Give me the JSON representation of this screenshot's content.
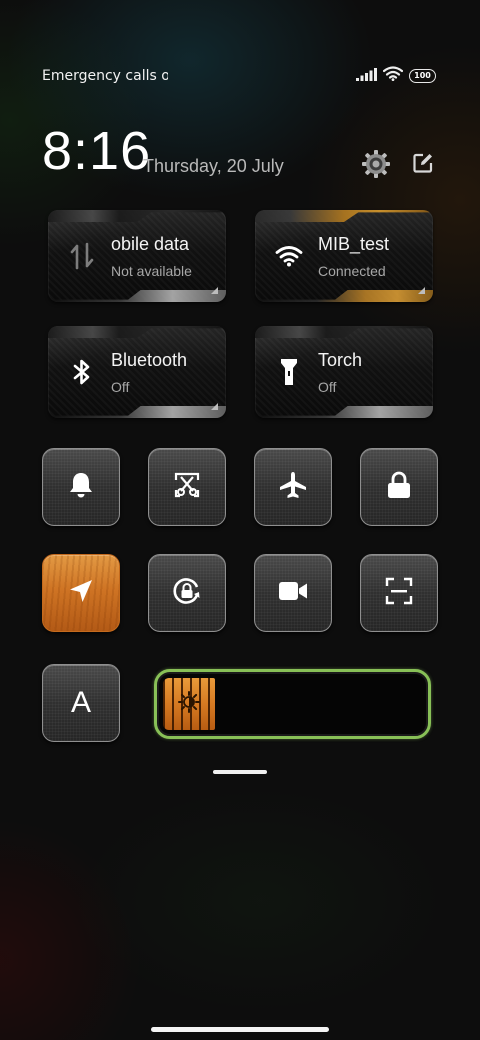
{
  "status_bar": {
    "carrier": "Emergency calls o",
    "battery": "100"
  },
  "header": {
    "time": "8:16",
    "date": "Thursday, 20 July",
    "settings_icon": "gear-icon",
    "edit_icon": "edit-icon"
  },
  "big_tiles": [
    {
      "title": "obile data",
      "subtitle": "Not available",
      "icon": "mobile-data-icon",
      "active": false
    },
    {
      "title": "MIB_test",
      "subtitle": "Connected",
      "icon": "wifi-icon",
      "active": true
    },
    {
      "title": "Bluetooth",
      "subtitle": "Off",
      "icon": "bluetooth-icon",
      "active": false
    },
    {
      "title": "Torch",
      "subtitle": "Off",
      "icon": "torch-icon",
      "active": false
    }
  ],
  "toggles": [
    {
      "icon": "bell-icon",
      "active": false
    },
    {
      "icon": "screenshot-icon",
      "active": false
    },
    {
      "icon": "airplane-icon",
      "active": false
    },
    {
      "icon": "lock-icon",
      "active": false
    },
    {
      "icon": "location-icon",
      "active": true
    },
    {
      "icon": "rotation-lock-icon",
      "active": false
    },
    {
      "icon": "video-camera-icon",
      "active": false
    },
    {
      "icon": "scan-icon",
      "active": false
    }
  ],
  "font_size_button": {
    "label": "A"
  },
  "brightness": {
    "level": 0.2,
    "icon": "brightness-icon",
    "accent": "#88c057",
    "fill": "#d67a22"
  },
  "colors": {
    "active_orange": "#c98d2b",
    "location_orange": "#cf7424"
  }
}
